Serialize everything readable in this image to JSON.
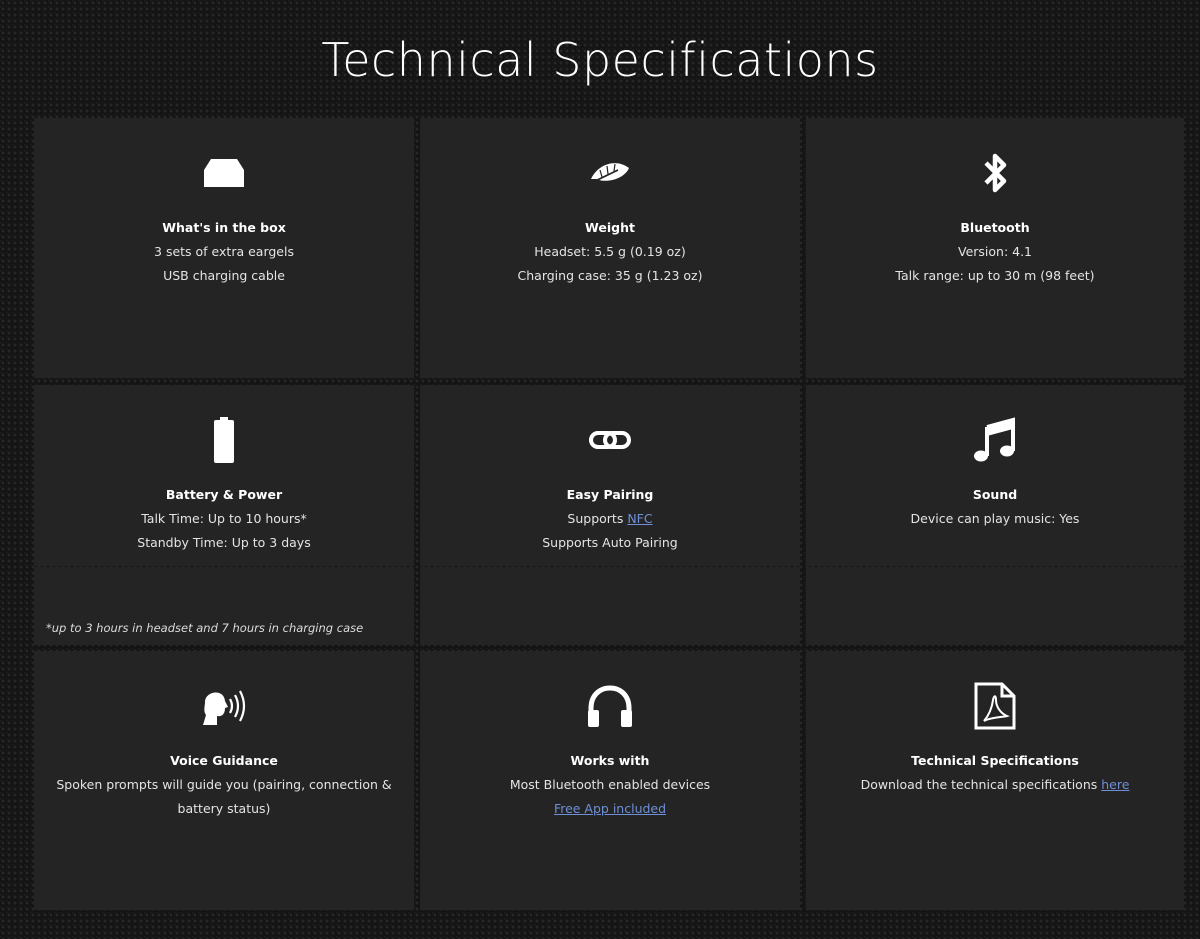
{
  "title": "Technical Specifications",
  "cards": [
    {
      "title": "What's in the box",
      "icon": "box-icon",
      "lines": [
        "3 sets of extra eargels",
        "USB charging cable"
      ]
    },
    {
      "title": "Weight",
      "icon": "feather-icon",
      "lines": [
        "Headset: 5.5 g (0.19 oz)",
        "Charging case: 35 g (1.23 oz)"
      ]
    },
    {
      "title": "Bluetooth",
      "icon": "bluetooth-icon",
      "lines": [
        "Version: 4.1",
        "Talk range: up to 30 m (98 feet)"
      ]
    },
    {
      "title": "Battery & Power",
      "icon": "battery-icon",
      "lines": [
        "Talk Time: Up to 10 hours*",
        "Standby Time: Up to 3 days"
      ]
    },
    {
      "title": "Easy Pairing",
      "icon": "link-icon",
      "lines": [
        "Supports ",
        "Supports Auto Pairing"
      ],
      "link": "NFC"
    },
    {
      "title": "Sound",
      "icon": "music-note-icon",
      "lines": [
        "Device can play music: Yes"
      ]
    },
    {
      "title": "Voice Guidance",
      "icon": "speaking-head-icon",
      "lines": [
        "Spoken prompts will guide you (pairing, connection &",
        "battery status)"
      ]
    },
    {
      "title": "Works with",
      "icon": "headphones-icon",
      "lines": [
        "Most Bluetooth enabled devices"
      ],
      "link": "Free App included"
    },
    {
      "title": "Technical Specifications",
      "icon": "pdf-document-icon",
      "lines": [
        "Download the technical specifications "
      ],
      "link": "here"
    }
  ],
  "footnote": "*up to 3 hours in headset and 7 hours in charging case"
}
